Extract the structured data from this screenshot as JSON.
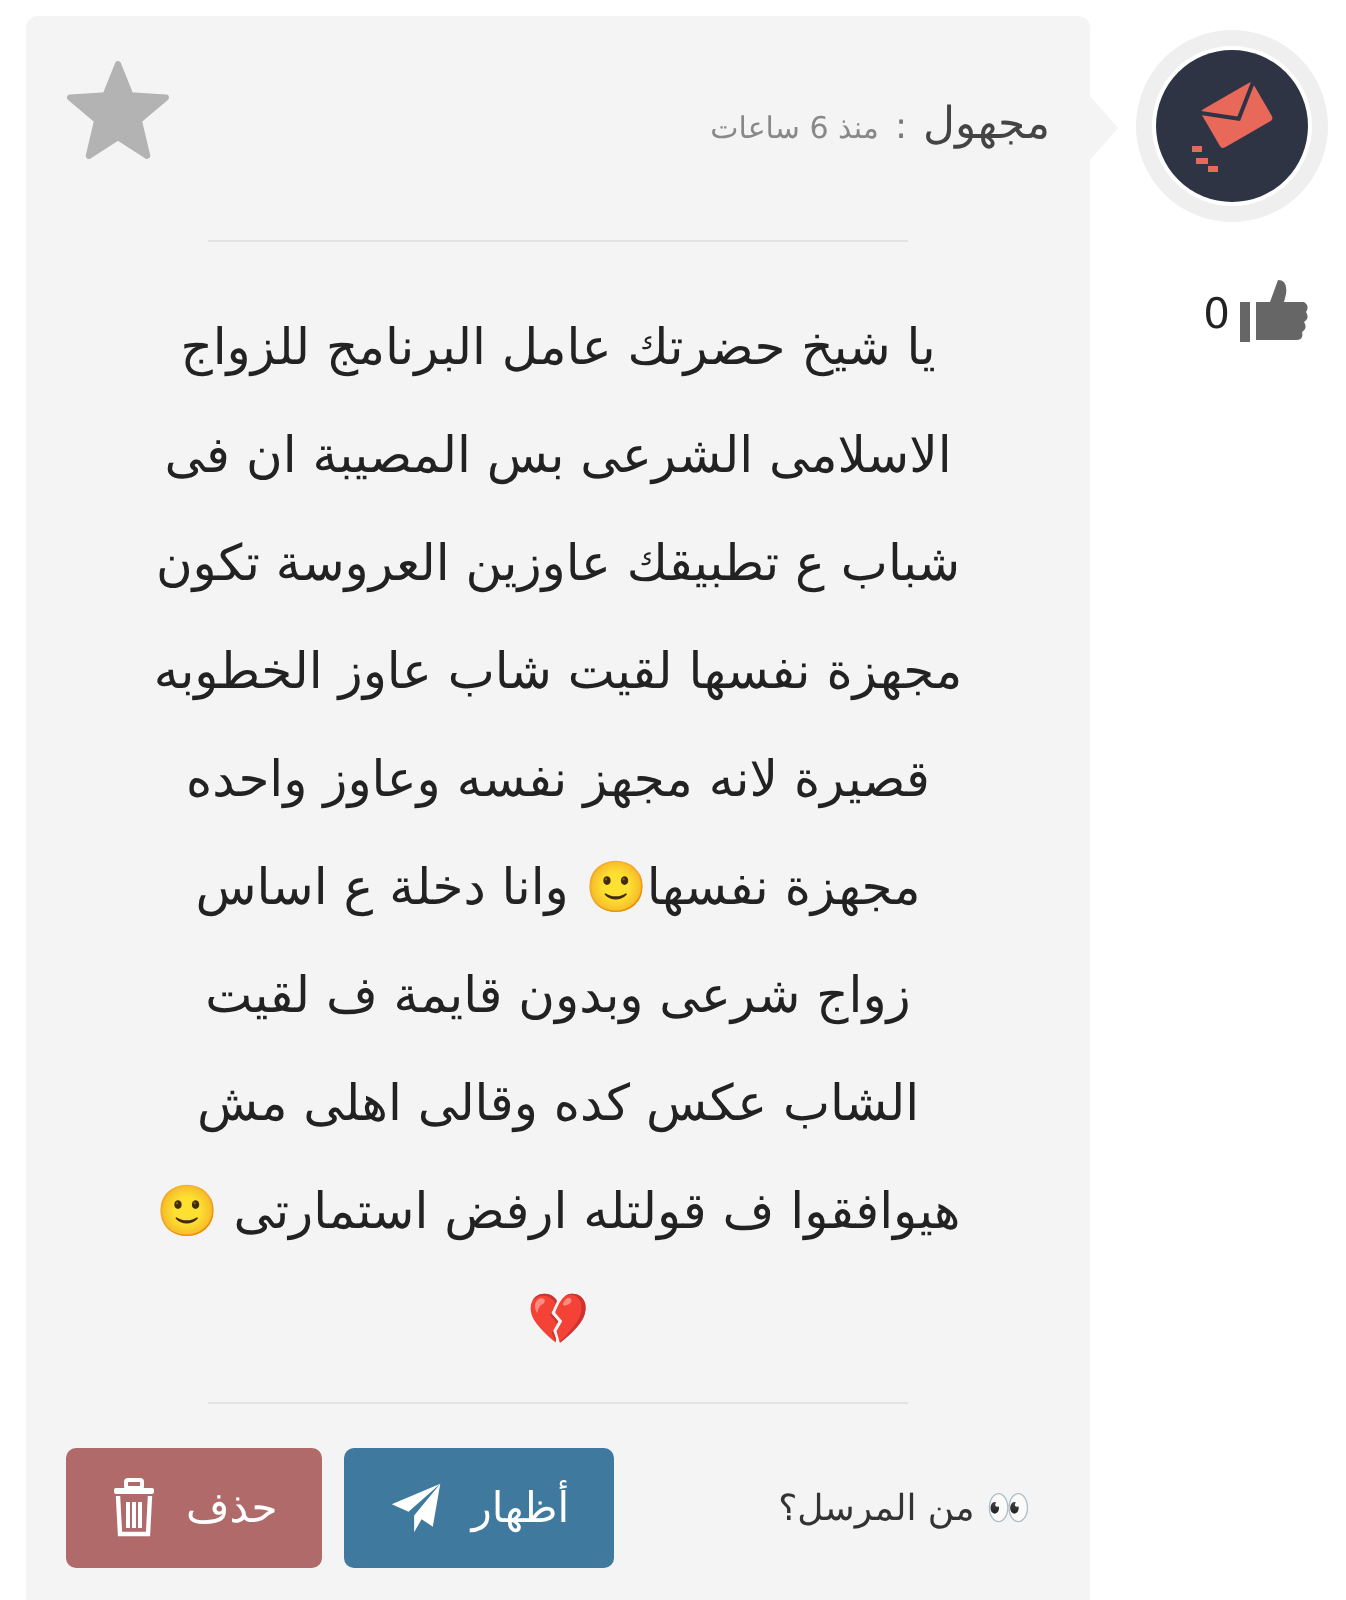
{
  "message": {
    "author": "مجهول",
    "separator": ":",
    "time": "منذ 6 ساعات",
    "starred": false,
    "lines": [
      "يا شيخ حضرتك عامل البرنامج للزواج",
      "الاسلامى الشرعى بس المصيبة ان فى",
      "شباب ع تطبيقك عاوزين العروسة تكون",
      "مجهزة نفسها لقيت شاب عاوز الخطوبه",
      "قصيرة لانه مجهز نفسه وعاوز واحده",
      "مجهزة نفسها🙂 وانا دخلة ع اساس",
      "زواج شرعى وبدون قايمة ف لقيت",
      "الشاب عكس كده وقالى اهلى مش",
      "هيوافقوا ف قولتله ارفض استمارتى 🙂",
      "💔"
    ],
    "sender_prompt": "👀 من المرسل؟",
    "buttons": [
      {
        "kind": "reveal",
        "label": "أظهار"
      },
      {
        "kind": "delete",
        "label": "حذف"
      }
    ]
  },
  "likes": {
    "count": "0"
  }
}
